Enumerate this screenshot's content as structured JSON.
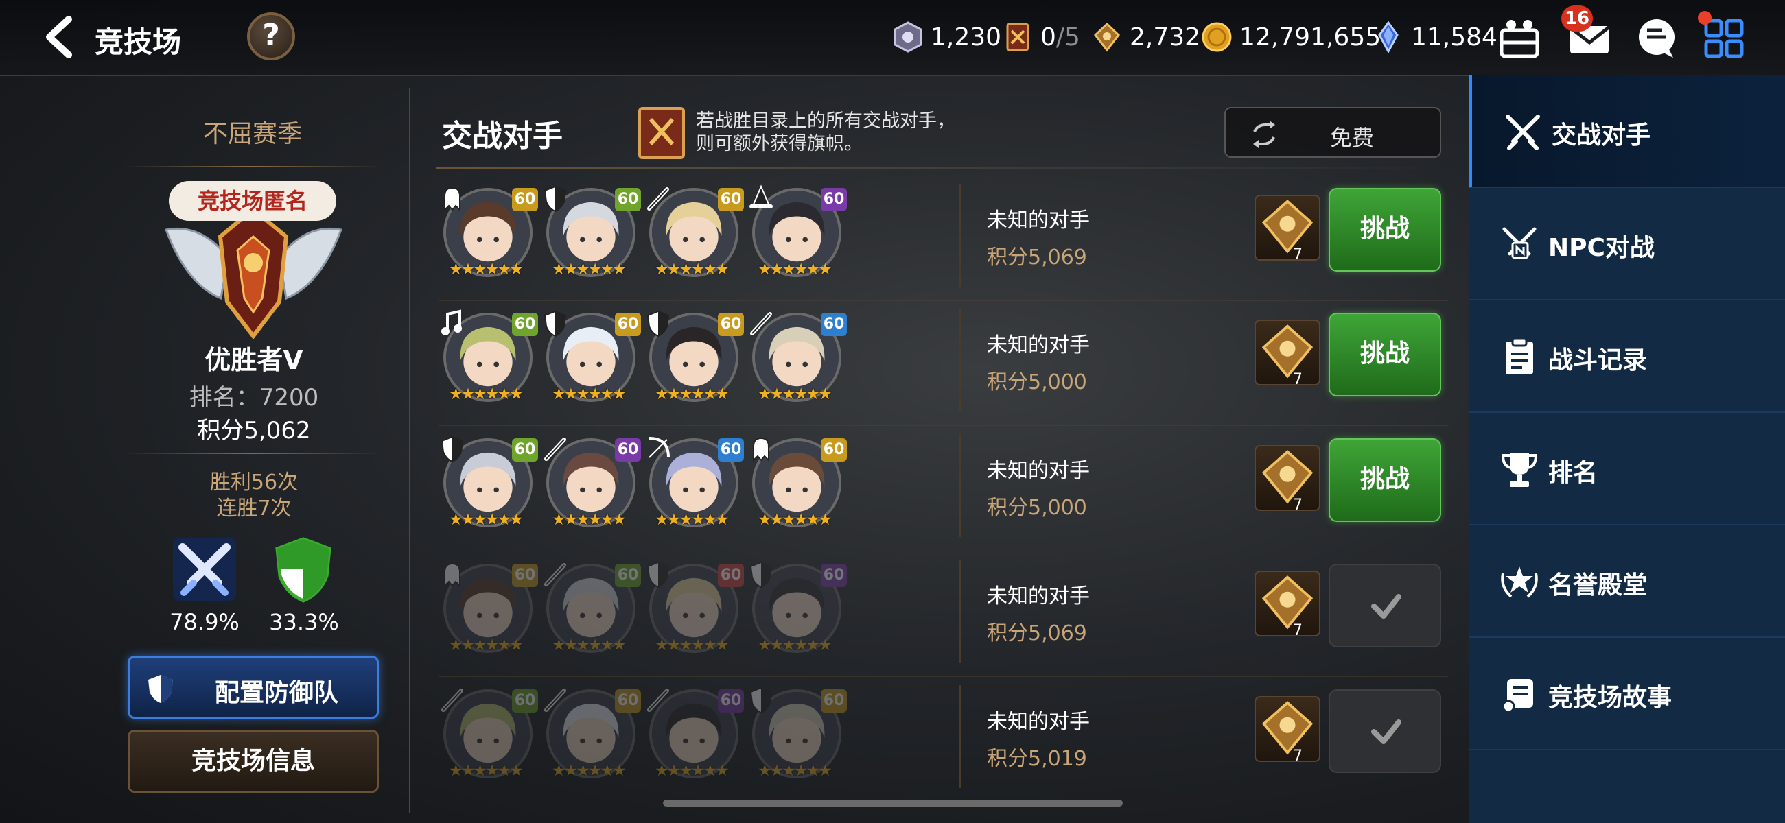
{
  "header": {
    "title": "竞技场",
    "help_label": "?",
    "resources": [
      {
        "icon": "arena-token-icon",
        "value": "1,230"
      },
      {
        "icon": "flag-ticket-icon",
        "value": "0",
        "max": "/5"
      },
      {
        "icon": "honor-medal-icon",
        "value": "2,732"
      },
      {
        "icon": "gold-coin-icon",
        "value": "12,791,655"
      },
      {
        "icon": "crystal-icon",
        "value": "11,584"
      }
    ],
    "mail_count": "16"
  },
  "left_panel": {
    "season": "不屈赛季",
    "emblem_label": "竞技场匿名",
    "tier": "优胜者V",
    "rank": "排名：7200",
    "points": "积分5,062",
    "wins": "胜利56次",
    "streak": "连胜7次",
    "attack_rate": "78.9%",
    "defense_rate": "33.3%",
    "defense_button": "配置防御队",
    "info_button": "竞技场信息"
  },
  "opponents": {
    "title": "交战对手",
    "notice_line1": "若战胜目录上的所有交战对手，",
    "notice_line2": "则可额外获得旗帜。",
    "refresh_label": "免费",
    "challenge_label": "挑战",
    "list": [
      {
        "name": "未知的对手",
        "points": "积分5,069",
        "reward": "7",
        "status": "challenge",
        "heroes": [
          {
            "level": "60",
            "lvl_color": "#c89a1e",
            "cls": "ghost"
          },
          {
            "level": "60",
            "lvl_color": "#6fa52a",
            "cls": "shield"
          },
          {
            "level": "60",
            "lvl_color": "#c89a1e",
            "cls": "sword"
          },
          {
            "level": "60",
            "lvl_color": "#7a3aa8",
            "cls": "hat"
          }
        ]
      },
      {
        "name": "未知的对手",
        "points": "积分5,000",
        "reward": "7",
        "status": "challenge",
        "heroes": [
          {
            "level": "60",
            "lvl_color": "#6fa52a",
            "cls": "note"
          },
          {
            "level": "60",
            "lvl_color": "#c89a1e",
            "cls": "shield"
          },
          {
            "level": "60",
            "lvl_color": "#c89a1e",
            "cls": "shield"
          },
          {
            "level": "60",
            "lvl_color": "#2f7fd0",
            "cls": "sword"
          }
        ]
      },
      {
        "name": "未知的对手",
        "points": "积分5,000",
        "reward": "7",
        "status": "challenge",
        "heroes": [
          {
            "level": "60",
            "lvl_color": "#6fa52a",
            "cls": "shield"
          },
          {
            "level": "60",
            "lvl_color": "#7a3aa8",
            "cls": "sword"
          },
          {
            "level": "60",
            "lvl_color": "#2f7fd0",
            "cls": "bow"
          },
          {
            "level": "60",
            "lvl_color": "#c89a1e",
            "cls": "ghost"
          }
        ]
      },
      {
        "name": "未知的对手",
        "points": "积分5,069",
        "reward": "7",
        "status": "done",
        "heroes": [
          {
            "level": "60",
            "lvl_color": "#c89a1e",
            "cls": "ghost"
          },
          {
            "level": "60",
            "lvl_color": "#6fa52a",
            "cls": "sword"
          },
          {
            "level": "60",
            "lvl_color": "#d04040",
            "cls": "shield"
          },
          {
            "level": "60",
            "lvl_color": "#7a3aa8",
            "cls": "shield"
          }
        ]
      },
      {
        "name": "未知的对手",
        "points": "积分5,019",
        "reward": "7",
        "status": "done",
        "heroes": [
          {
            "level": "60",
            "lvl_color": "#6fa52a",
            "cls": "sword"
          },
          {
            "level": "60",
            "lvl_color": "#c89a1e",
            "cls": "sword"
          },
          {
            "level": "60",
            "lvl_color": "#7a3aa8",
            "cls": "sword"
          },
          {
            "level": "60",
            "lvl_color": "#c89a1e",
            "cls": "shield"
          }
        ]
      }
    ]
  },
  "menu": {
    "items": [
      {
        "label": "交战对手",
        "icon": "crossed-swords-icon",
        "active": true
      },
      {
        "label": "NPC对战",
        "icon": "npc-swords-icon",
        "active": false
      },
      {
        "label": "战斗记录",
        "icon": "clipboard-icon",
        "active": false
      },
      {
        "label": "排名",
        "icon": "trophy-icon",
        "active": false
      },
      {
        "label": "名誉殿堂",
        "icon": "laurel-star-icon",
        "active": false
      },
      {
        "label": "竞技场故事",
        "icon": "scroll-icon",
        "active": false
      }
    ]
  },
  "colors": {
    "challenge_green": "#3fa537",
    "menu_bg": "#132a44",
    "accent_blue": "#2a8cff",
    "gold_text": "#c9a678"
  }
}
